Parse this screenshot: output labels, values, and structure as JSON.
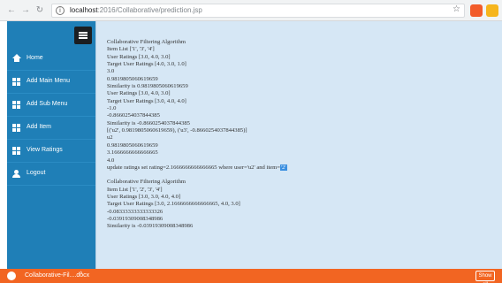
{
  "browser": {
    "url_host": "localhost",
    "url_path": ":2016/Collaborative/prediction.jsp",
    "back_icon": "arrow-left",
    "forward_icon": "arrow-right",
    "reload_icon": "reload",
    "info_icon": "info-circle",
    "star_icon": "star",
    "extension_colors": [
      "#f25c2a",
      "#f6b51c"
    ]
  },
  "sidebar": {
    "bg_color": "#1f7fb7",
    "toggle_icon": "hamburger",
    "items": [
      {
        "label": "Home",
        "icon": "home"
      },
      {
        "label": "Add Main Menu",
        "icon": "grid"
      },
      {
        "label": "Add Sub Menu",
        "icon": "grid"
      },
      {
        "label": "Add Item",
        "icon": "grid"
      },
      {
        "label": "View Ratings",
        "icon": "grid"
      },
      {
        "label": "Logout",
        "icon": "user"
      }
    ]
  },
  "output": {
    "block1": [
      "Collaborative Filtering Algorithm",
      "Item List ['1', '3', '4']",
      "User Ratings [3.0, 4.0, 3.0]",
      "Target User Ratings [4.0, 3.0, 1.0]",
      "3.0",
      "0.9819805060619659",
      "Similarity is 0.9819805060619659",
      "User Ratings [3.0, 4.0, 3.0]",
      "Target User Ratings [3.0, 4.0, 4.0]",
      "-1.0",
      "-0.8660254037844385",
      "Similarity is -0.8660254037844385",
      "[('u2', 0.9819805060619659), ('u3', -0.8660254037844385)]",
      "u2",
      "0.9819805060619659",
      "3.1666666666666665",
      "4.0"
    ],
    "update_line": "update ratings set rating=2.1666666666666665 where user='u2' and item=",
    "update_item": "'2'",
    "block2": [
      "Collaborative Filtering Algorithm",
      "Item List ['1', '2', '3', '4']",
      "User Ratings [3.0, 3.0, 4.0, 4.0]",
      "Target User Ratings [3.0, 2.1666666666666665, 4.0, 3.0]",
      "-0.08333333333333326",
      "-0.03919309008348986",
      "Similarity is -0.03919309008348986"
    ]
  },
  "taskbar": {
    "item_label": "Collaborative-Fil....docx",
    "caret": "^",
    "show_all_label": "Show all",
    "bg_color": "#f26522"
  }
}
